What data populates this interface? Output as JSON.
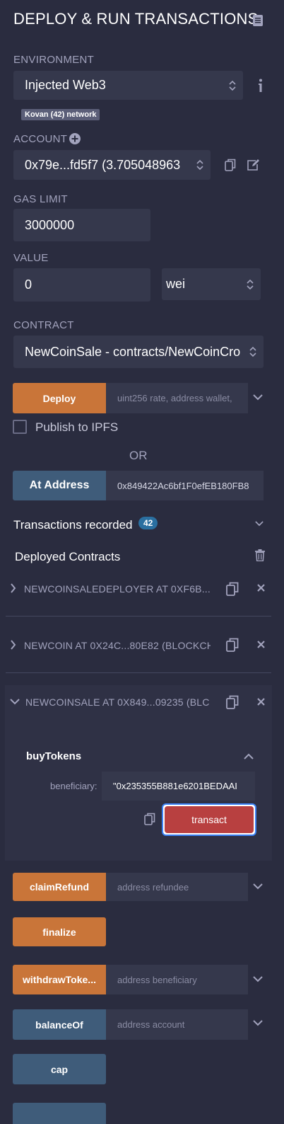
{
  "header": {
    "title": "DEPLOY & RUN TRANSACTIONS"
  },
  "environment": {
    "label": "ENVIRONMENT",
    "value": "Injected Web3",
    "network_badge": "Kovan (42) network"
  },
  "account": {
    "label": "ACCOUNT",
    "value": "0x79e...fd5f7 (3.705048963"
  },
  "gas": {
    "label": "GAS LIMIT",
    "value": "3000000"
  },
  "value": {
    "label": "VALUE",
    "amount": "0",
    "unit": "wei"
  },
  "contract": {
    "label": "CONTRACT",
    "value": "NewCoinSale - contracts/NewCoinCro"
  },
  "deploy": {
    "button": "Deploy",
    "placeholder": "uint256 rate, address wallet,"
  },
  "publish": {
    "label": "Publish to IPFS"
  },
  "or_text": "OR",
  "at_address": {
    "button": "At Address",
    "value": "0x849422Ac6bf1F0efEB180FB8"
  },
  "transactions": {
    "label": "Transactions recorded",
    "count": "42"
  },
  "deployed": {
    "label": "Deployed Contracts",
    "instances": [
      {
        "title": "NEWCOINSALEDEPLOYER AT 0XF6B...C"
      },
      {
        "title": "NEWCOIN AT 0X24C...80E82 (BLOCKCH"
      },
      {
        "title": "NEWCOINSALE AT 0X849...09235 (BLC"
      }
    ]
  },
  "buy_tokens": {
    "title": "buyTokens",
    "param_label": "beneficiary:",
    "param_value": "\"0x235355B881e6201BEDAAI",
    "transact": "transact"
  },
  "functions": [
    {
      "label": "claimRefund",
      "placeholder": "address refundee"
    },
    {
      "label": "finalize"
    },
    {
      "label": "withdrawToke...",
      "placeholder": "address beneficiary"
    },
    {
      "label": "balanceOf",
      "placeholder": "address account"
    },
    {
      "label": "cap"
    }
  ],
  "colors": {
    "background": "#2a2c3f",
    "orange": "#c97539",
    "blue": "#3f5c7a",
    "danger": "#b84040",
    "field": "#35384c"
  }
}
